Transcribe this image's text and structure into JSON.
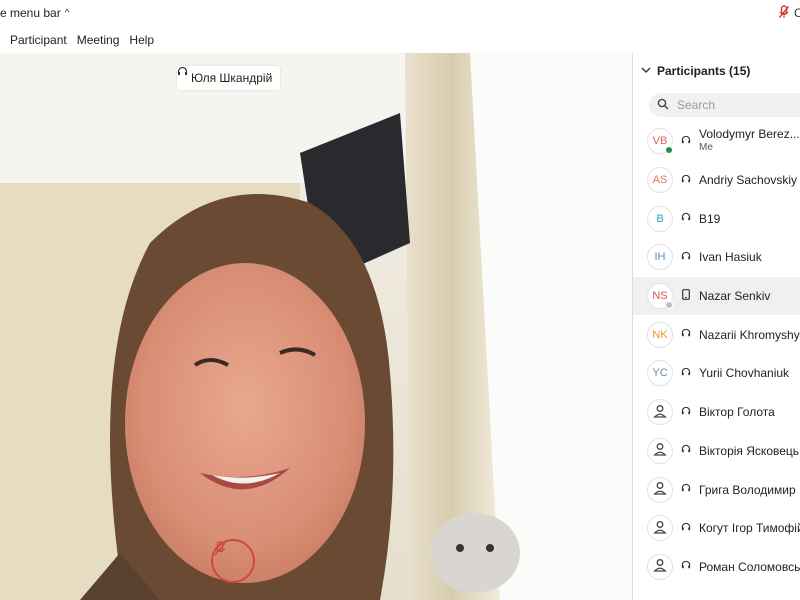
{
  "topbar": {
    "title": "e menu bar",
    "caret": "^",
    "mic_text": "C"
  },
  "menu": {
    "items": [
      {
        "label": "Participant"
      },
      {
        "label": "Meeting"
      },
      {
        "label": "Help"
      }
    ]
  },
  "video": {
    "speaker_name": "Юля Шкандрій"
  },
  "participants": {
    "header": "Participants (15)",
    "search_placeholder": "Search",
    "list": [
      {
        "initials": "VB",
        "name": "Volodymyr Berez...",
        "sub": "Me",
        "device": "headset",
        "color": "#d96b5c",
        "status": "#1e8f4e"
      },
      {
        "initials": "AS",
        "name": "Andriy Sachovskiy",
        "sub": "",
        "device": "headset",
        "color": "#e07a4f",
        "status": ""
      },
      {
        "initials": "B",
        "name": "B19",
        "sub": "",
        "device": "headset",
        "color": "#3b9ac2",
        "status": ""
      },
      {
        "initials": "IH",
        "name": "Ivan Hasiuk",
        "sub": "",
        "device": "headset",
        "color": "#5a8fc2",
        "status": ""
      },
      {
        "initials": "NS",
        "name": "Nazar Senkiv",
        "sub": "",
        "device": "phone",
        "color": "#e0524a",
        "status": "#bdbdbd"
      },
      {
        "initials": "NK",
        "name": "Nazarii Khromyshyn",
        "sub": "",
        "device": "headset",
        "color": "#e59a2e",
        "status": ""
      },
      {
        "initials": "YC",
        "name": "Yurii Chovhaniuk",
        "sub": "",
        "device": "headset",
        "color": "#6a8aa0",
        "status": ""
      },
      {
        "initials": "",
        "name": "Віктор Голота",
        "sub": "",
        "device": "headset",
        "color": "#444444",
        "status": ""
      },
      {
        "initials": "",
        "name": "Вікторія Ясковець",
        "sub": "",
        "device": "headset",
        "color": "#444444",
        "status": ""
      },
      {
        "initials": "",
        "name": "Грига Володимир",
        "sub": "",
        "device": "headset",
        "color": "#444444",
        "status": ""
      },
      {
        "initials": "",
        "name": "Когут Ігор Тимофій",
        "sub": "",
        "device": "headset",
        "color": "#444444",
        "status": ""
      },
      {
        "initials": "",
        "name": "Роман Соломовськ",
        "sub": "",
        "device": "headset",
        "color": "#444444",
        "status": ""
      }
    ]
  }
}
